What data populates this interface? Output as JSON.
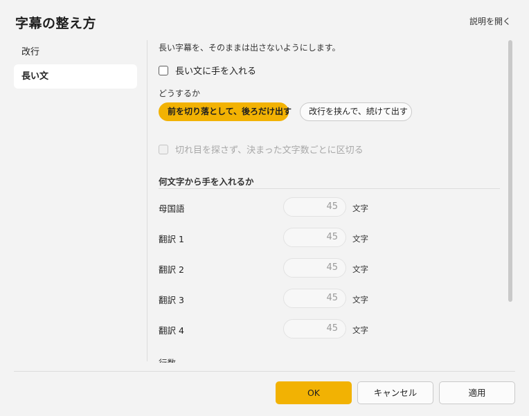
{
  "dialog": {
    "title": "字幕の整え方",
    "help_link": "説明を開く"
  },
  "sidebar": {
    "items": [
      {
        "label": "改行",
        "selected": false
      },
      {
        "label": "長い文",
        "selected": true
      }
    ]
  },
  "content": {
    "description": "長い字幕を、そのままは出さないようにします。",
    "enable_checkbox": {
      "label": "長い文に手を入れる",
      "checked": false
    },
    "method": {
      "label": "どうするか",
      "options": [
        {
          "label": "前を切り落として、後ろだけ出す",
          "selected": true
        },
        {
          "label": "改行を挟んで、続けて出す",
          "selected": false
        }
      ]
    },
    "fixed_split_checkbox": {
      "label": "切れ目を探さず、決まった文字数ごとに区切る",
      "checked": false,
      "disabled": true
    },
    "threshold": {
      "heading": "何文字から手を入れるか",
      "unit": "文字",
      "rows": [
        {
          "label": "母国語",
          "value": "45"
        },
        {
          "label": "翻訳 1",
          "value": "45"
        },
        {
          "label": "翻訳 2",
          "value": "45"
        },
        {
          "label": "翻訳 3",
          "value": "45"
        },
        {
          "label": "翻訳 4",
          "value": "45"
        }
      ]
    },
    "next_section_label": "行数"
  },
  "footer": {
    "ok": "OK",
    "cancel": "キャンセル",
    "apply": "適用"
  },
  "colors": {
    "accent": "#f2b203",
    "background": "#f3f3f3"
  }
}
